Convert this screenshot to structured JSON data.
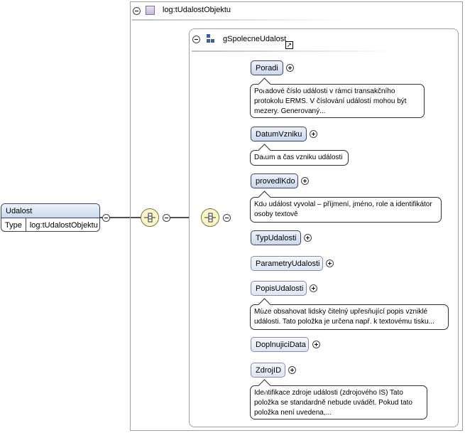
{
  "root": {
    "name": "Udalost",
    "type_label": "Type",
    "type_value": "log:tUdalostObjektu"
  },
  "complex_type": {
    "title": "log:tUdalostObjektu"
  },
  "group": {
    "title": "gSpolecneUdalost"
  },
  "elements": [
    {
      "name": "Poradi",
      "optional": false,
      "note": "Pořadové číslo události v rámci transakčního protokolu ERMS. V číslování událostí mohou být mezery. Generovaný..."
    },
    {
      "name": "DatumVzniku",
      "optional": false,
      "note": "Datum a čas vzniku události"
    },
    {
      "name": "provedlKdo",
      "optional": false,
      "note": "Kdo událost vyvolal – příjmení, jméno, role a identifikátor osoby textově"
    },
    {
      "name": "TypUdalosti",
      "optional": false,
      "note": ""
    },
    {
      "name": "ParametryUdalosti",
      "optional": true,
      "note": ""
    },
    {
      "name": "PopisUdalosti",
      "optional": true,
      "note": "Může obsahovat lidsky čitelný upřesňující popis vzniklé události. Tato položka je určena např. k textovému tisku..."
    },
    {
      "name": "DoplnujiciData",
      "optional": true,
      "note": ""
    },
    {
      "name": "ZdrojID",
      "optional": true,
      "note": "Identifikace zdroje události (zdrojového IS) Tato položka se standardně nebude uvádět. Pokud tato položka není uvedena,..."
    }
  ],
  "colors": {
    "element_fill": "#c9d8ee",
    "sequence_fill": "#fbf5c8",
    "line": "#505050"
  }
}
